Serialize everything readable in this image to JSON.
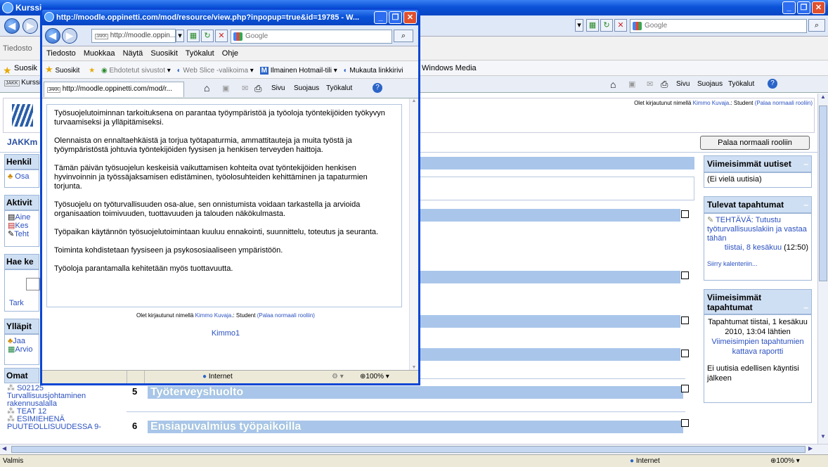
{
  "background_window": {
    "title": "Kurssi",
    "search_engine": "Google",
    "menu_first": "Tiedosto",
    "favorites_label": "Suosik",
    "fav_windows_media": "Windows Media",
    "tab_label": "Kurssi",
    "toolbar_right": {
      "page": "Sivu",
      "safety": "Suojaus",
      "tools": "Työkalut"
    },
    "login_text_prefix": "Olet kirjautunut nimellä",
    "login_user": "Kimmo Kuvaja",
    "login_role": ".: Student",
    "login_return": "(Palaa normaali rooliin)",
    "return_role_button": "Palaa normaali rooliin",
    "left_blocks": {
      "course_short": "JAKKm",
      "people": "Henkil",
      "people_item": "Osa",
      "activities": "Aktivit",
      "activity_items": [
        "Aine",
        "Kes",
        "Teht"
      ],
      "search": "Hae ke",
      "search_btn": "Tark",
      "admin": "Ylläpit",
      "admin_items": [
        "Jaa",
        "Arvio"
      ],
      "my_courses": "Omat",
      "my_course_items": [
        "S02125 Turvallisuusjohtaminen rakennusalalla",
        "TEAT 12",
        "ESIMIEHENÄ PUUTEOLLISUUDESSA 9-"
      ]
    },
    "right_blocks": {
      "news_title": "Viimeisimmät uutiset",
      "news_empty": "(Ei vielä uutisia)",
      "upcoming_title": "Tulevat tapahtumat",
      "upcoming_event": "TEHTÄVÄ: Tutustu työturvallisuuslakiin ja vastaa tähän",
      "upcoming_date": "tiistai, 8 kesäkuu",
      "upcoming_time": "(12:50)",
      "calendar_link": "Siirry kalenteriin...",
      "recent_title": "Viimeisimmät tapahtumat",
      "recent_since": "Tapahtumat tiistai, 1 kesäkuu 2010, 13:04 lähtien",
      "recent_report": "Viimeisimpien tapahtumien kattava raportti",
      "recent_none": "Ei uutisia edellisen käyntisi jälkeen"
    },
    "sections": [
      {
        "num": "5",
        "title": "Työterveyshuolto"
      },
      {
        "num": "6",
        "title": "Ensiapuvalmius työpaikoilla"
      }
    ],
    "status": "Valmis",
    "zone": "Internet",
    "zoom": "100%"
  },
  "popup": {
    "title": "http://moodle.oppinetti.com/mod/resource/view.php?inpopup=true&id=19785 - W...",
    "address": "http://moodle.oppin...",
    "search_engine": "Google",
    "menu": [
      "Tiedosto",
      "Muokkaa",
      "Näytä",
      "Suosikit",
      "Työkalut",
      "Ohje"
    ],
    "fav": {
      "favorites": "Suosikit",
      "suggested": "Ehdotetut sivustot",
      "webslice": "Web Slice -valikoima",
      "hotmail": "Ilmainen Hotmail-tili",
      "links": "Mukauta linkkirivi"
    },
    "tab": "http://moodle.oppinetti.com/mod/r...",
    "toolbar": {
      "page": "Sivu",
      "safety": "Suojaus",
      "tools": "Työkalut"
    },
    "paragraphs": [
      "Työsuojelutoiminnan tarkoituksena on parantaa työympäristöä ja työoloja työntekijöiden työkyvyn turvaamiseksi ja ylläpitämiseksi.",
      "Olennaista on ennaltaehkäistä ja torjua työtapaturmia, ammattitauteja ja muita työstä ja työympäristöstä johtuvia työntekijöiden fyysisen ja henkisen terveyden haittoja.",
      "Tämän päivän työsuojelun keskeisiä vaikuttamisen kohteita ovat työntekijöiden henkisen hyvinvoinnin ja työssäjaksamisen edistäminen, työolosuhteiden kehittäminen ja tapaturmien torjunta.",
      "Työsuojelu on työturvallisuuden osa-alue, sen onnistumista voidaan tarkastella ja arvioida organisaation toimivuuden, tuottavuuden ja talouden näkökulmasta.",
      "Työpaikan käytännön työsuojelutoimintaan kuuluu ennakointi, suunnittelu, toteutus ja seuranta.",
      "Toiminta kohdistetaan fyysiseen ja psykososiaaliseen ympäristöön.",
      "Työoloja parantamalla kehitetään myös tuottavuutta."
    ],
    "login_prefix": "Olet kirjautunut nimellä",
    "login_user": "Kimmo Kuvaja",
    "login_role": ".: Student",
    "login_return": "(Palaa normaali rooliin)",
    "footer_link": "Kimmo1",
    "zone": "Internet",
    "zoom": "100%"
  }
}
